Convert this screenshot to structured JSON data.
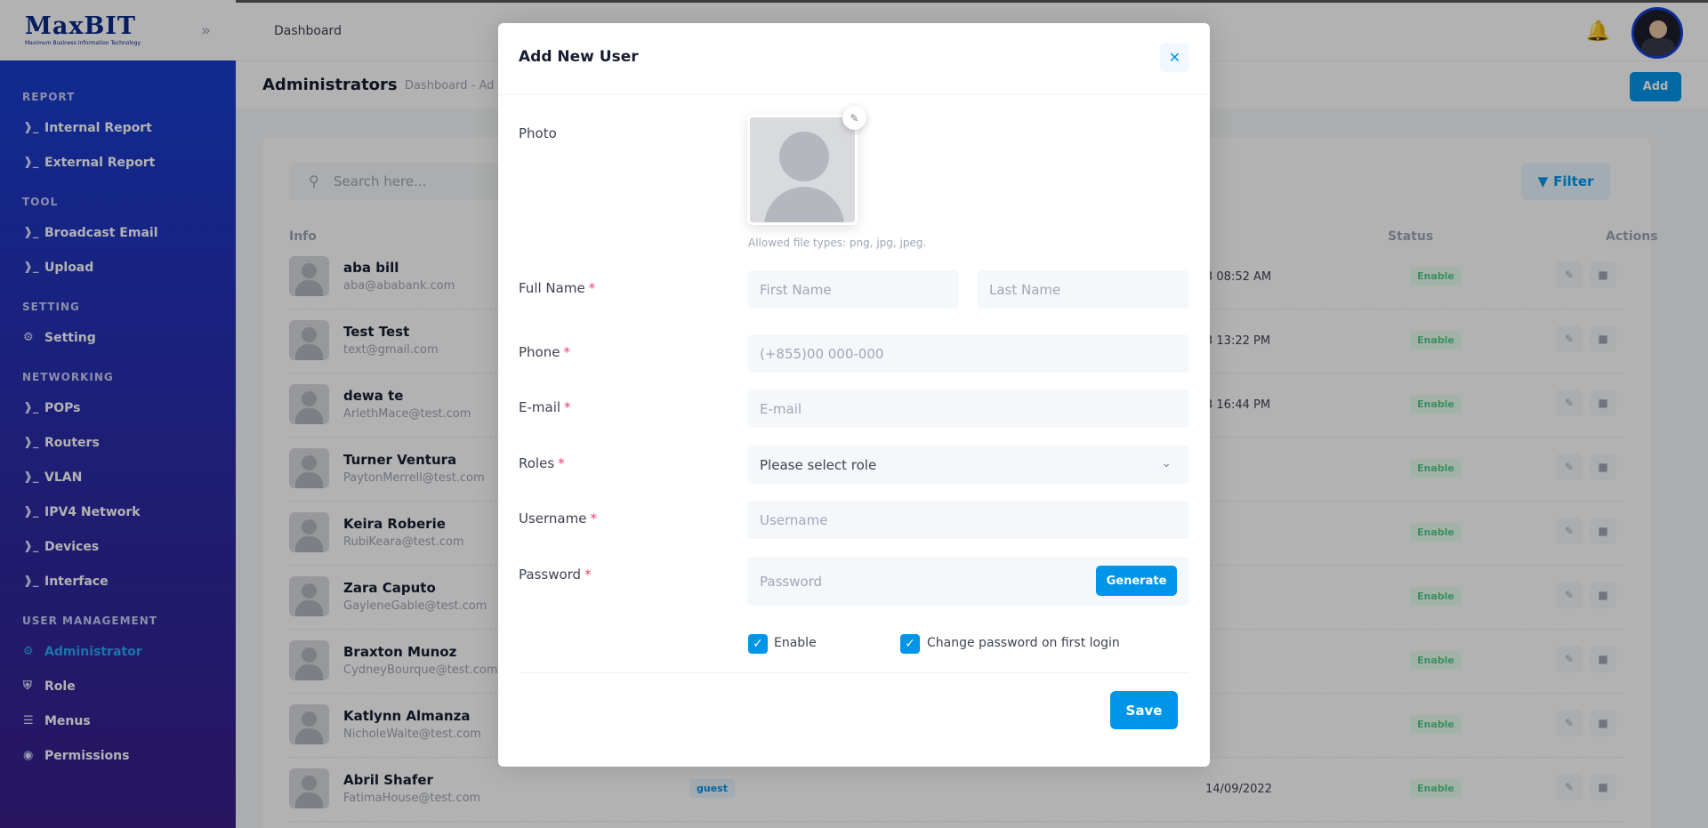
{
  "brand": {
    "logo_text": "MaxBIT",
    "logo_subtitle": "Maximum Business Information Technology"
  },
  "header": {
    "crumb": "Dashboard"
  },
  "sidebar": {
    "sections": [
      {
        "title": "REPORT",
        "items": [
          "Internal Report",
          "External Report"
        ]
      },
      {
        "title": "TOOL",
        "items": [
          "Broadcast Email",
          "Upload"
        ]
      },
      {
        "title": "SETTING",
        "items": [
          "Setting"
        ]
      },
      {
        "title": "NETWORKING",
        "items": [
          "POPs",
          "Routers",
          "VLAN",
          "IPV4 Network",
          "Devices",
          "Interface"
        ]
      },
      {
        "title": "USER MANAGEMENT",
        "items": [
          "Administrator",
          "Role",
          "Menus",
          "Permissions"
        ]
      }
    ],
    "active_item": "Administrator"
  },
  "page": {
    "title": "Administrators",
    "breadcrumb": "Dashboard - Ad",
    "add_label": "Add",
    "search_placeholder": "Search here...",
    "filter_label": "Filter",
    "columns": {
      "info": "Info",
      "status": "Status",
      "actions": "Actions"
    }
  },
  "table": {
    "rows": [
      {
        "name": "aba bill",
        "email": "aba@ababank.com",
        "date": "3 08:52 AM",
        "status": "Enable"
      },
      {
        "name": "Test Test",
        "email": "text@gmail.com",
        "date": "3 13:22 PM",
        "status": "Enable"
      },
      {
        "name": "dewa te",
        "email": "ArlethMace@test.com",
        "date": "3 16:44 PM",
        "status": "Enable"
      },
      {
        "name": "Turner Ventura",
        "email": "PaytonMerrell@test.com",
        "date": "",
        "status": "Enable"
      },
      {
        "name": "Keira Roberie",
        "email": "RubiKeara@test.com",
        "date": "",
        "status": "Enable"
      },
      {
        "name": "Zara Caputo",
        "email": "GayleneGable@test.com",
        "date": "",
        "status": "Enable"
      },
      {
        "name": "Braxton Munoz",
        "email": "CydneyBourque@test.com",
        "date": "",
        "status": "Enable"
      },
      {
        "name": "Katlynn Almanza",
        "email": "NicholeWaite@test.com",
        "date": "",
        "status": "Enable"
      },
      {
        "name": "Abril Shafer",
        "email": "FatimaHouse@test.com",
        "role": "guest",
        "date": "14/09/2022",
        "status": "Enable"
      }
    ]
  },
  "modal": {
    "title": "Add New User",
    "photo_label": "Photo",
    "photo_hint": "Allowed file types: png, jpg, jpeg.",
    "fullname_label": "Full Name",
    "first_name_placeholder": "First Name",
    "last_name_placeholder": "Last Name",
    "phone_label": "Phone",
    "phone_placeholder": "(+855)00 000-000",
    "email_label": "E-mail",
    "email_placeholder": "E-mail",
    "roles_label": "Roles",
    "roles_selected": "Please select role",
    "username_label": "Username",
    "username_placeholder": "Username",
    "password_label": "Password",
    "password_placeholder": "Password",
    "generate_label": "Generate",
    "enable_label": "Enable",
    "enable_checked": true,
    "change_pw_label": "Change password on first login",
    "change_pw_checked": true,
    "required_mark": "*",
    "save_label": "Save"
  },
  "colors": {
    "accent": "#0095e8",
    "sidebar_top": "#1640d6",
    "sidebar_bottom": "#3a1f8a",
    "required": "#f1416c",
    "success": "#50cd89"
  }
}
